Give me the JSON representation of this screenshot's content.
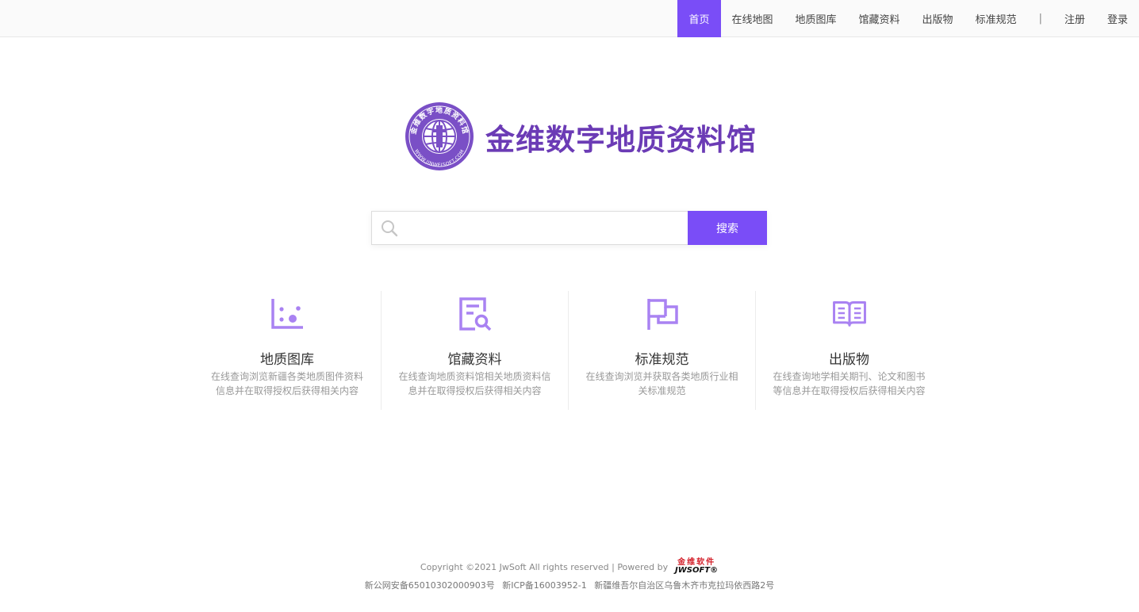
{
  "nav": {
    "items": [
      {
        "label": "首页",
        "active": true
      },
      {
        "label": "在线地图"
      },
      {
        "label": "地质图库"
      },
      {
        "label": "馆藏资料"
      },
      {
        "label": "出版物"
      },
      {
        "label": "标准规范"
      }
    ],
    "separator": "|",
    "register": "注册",
    "login": "登录"
  },
  "logo": {
    "title": "金维数字地质资料馆",
    "emblem_top_text": "金维数字地质资料馆",
    "emblem_bottom_text": "WWW.JINWEISOFT.COM"
  },
  "search": {
    "placeholder": "",
    "value": "",
    "button_label": "搜索"
  },
  "features": [
    {
      "icon": "chart-dots-icon",
      "title": "地质图库",
      "desc": "在线查询浏览新疆各类地质图件资料信息并在取得授权后获得相关内容"
    },
    {
      "icon": "document-search-icon",
      "title": "馆藏资料",
      "desc": "在线查询地质资料馆相关地质资料信息并在取得授权后获得相关内容"
    },
    {
      "icon": "flag-icon",
      "title": "标准规范",
      "desc": "在线查询浏览并获取各类地质行业相关标准规范"
    },
    {
      "icon": "open-book-icon",
      "title": "出版物",
      "desc": "在线查询地学相关期刊、论文和图书等信息并在取得授权后获得相关内容"
    }
  ],
  "footer": {
    "copyright": "Copyright ©2021 JwSoft All rights reserved | Powered by",
    "powered_logo_cn": "金维软件",
    "powered_logo_en": "JWSOFT®",
    "police_record": "新公网安备65010302000903号",
    "icp": "新ICP备16003952-1",
    "address": "新疆维吾尔自治区乌鲁木齐市克拉玛依西路2号"
  },
  "colors": {
    "accent": "#7a4df7",
    "logo_text": "#6b3bb5",
    "icon": "#a982f2"
  }
}
